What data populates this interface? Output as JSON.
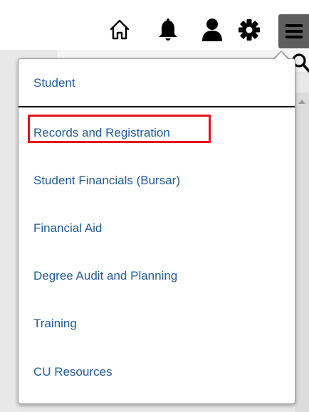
{
  "header": {
    "icons": [
      "home-icon",
      "bell-icon",
      "user-icon",
      "gear-icon",
      "menu-icon"
    ]
  },
  "menu": {
    "title": "Student",
    "items": [
      {
        "label": "Records and Registration",
        "highlighted": true
      },
      {
        "label": "Student Financials (Bursar)"
      },
      {
        "label": "Financial Aid"
      },
      {
        "label": "Degree Audit and Planning"
      },
      {
        "label": "Training"
      },
      {
        "label": "CU Resources"
      }
    ]
  },
  "colors": {
    "link": "#1f5b9a",
    "highlight": "#e4121d",
    "menu_button": "#5f5f5f"
  }
}
